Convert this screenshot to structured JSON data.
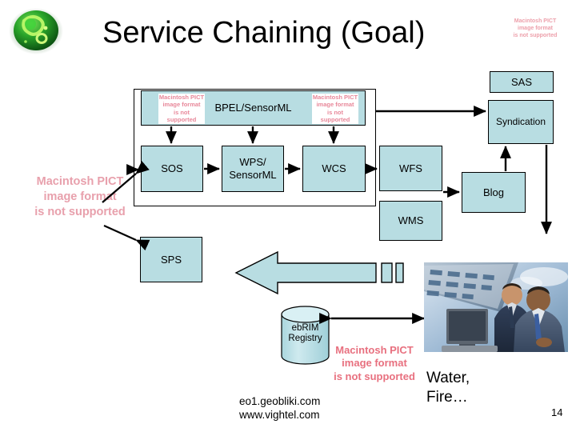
{
  "slide": {
    "title": "Service Chaining (Goal)",
    "page_number": "14",
    "background_color": "#ffffff",
    "box_fill_color": "#b8dde2",
    "box_border_color": "#000000",
    "placeholder_text_color": "#e8889a"
  },
  "logo": {
    "name": "green-orb-logo",
    "colors": [
      "#1f8b1f",
      "#46c832",
      "#9de84a",
      "#0c5c14"
    ]
  },
  "placeholders": {
    "top_right": "Macintosh PICT\nimage format\nis not supported",
    "left_middle": "Macintosh PICT\nimage format\nis not supported",
    "bpel_left": "Macintosh PICT\nimage format\nis not supported",
    "bpel_right": "Macintosh PICT\nimage format\nis not supported",
    "bottom_center": "Macintosh PICT\nimage format\nis not supported"
  },
  "diagram": {
    "boxes": [
      {
        "id": "bpel",
        "label": "BPEL/SensorML"
      },
      {
        "id": "sos",
        "label": "SOS"
      },
      {
        "id": "wps",
        "label": "WPS/\nSensorML"
      },
      {
        "id": "wcs",
        "label": "WCS"
      },
      {
        "id": "wfs",
        "label": "WFS"
      },
      {
        "id": "wms",
        "label": "WMS"
      },
      {
        "id": "sps",
        "label": "SPS"
      },
      {
        "id": "sas",
        "label": "SAS"
      },
      {
        "id": "syndication",
        "label": "Syndication"
      },
      {
        "id": "blog",
        "label": "Blog"
      }
    ],
    "cylinder": {
      "id": "ebrim",
      "label": "ebRIM\nRegistry"
    }
  },
  "footer": {
    "urls": "eo1.geobliki.com\nwww.vightel.com",
    "caption": "Water,\nFire…"
  }
}
